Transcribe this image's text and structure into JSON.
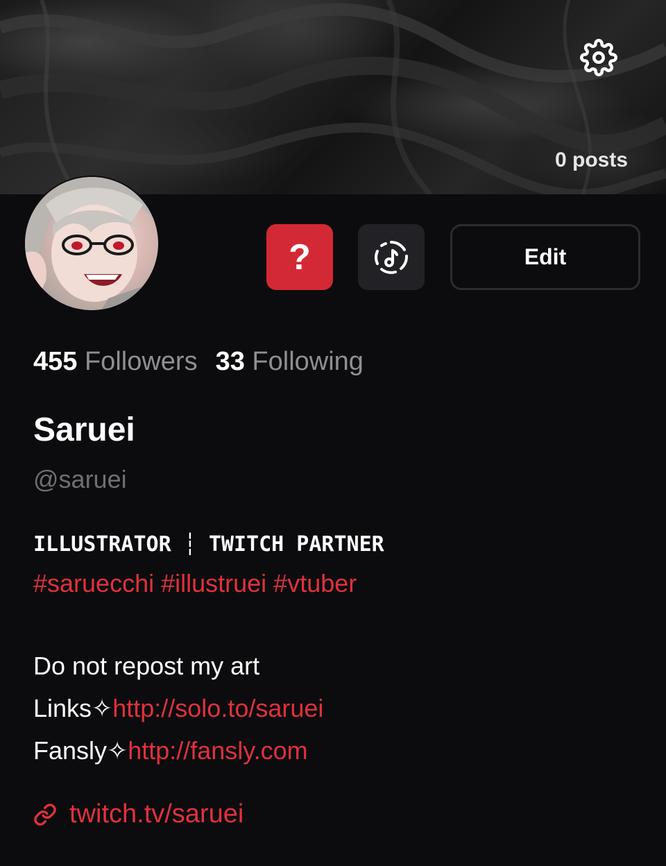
{
  "header": {
    "posts_label": "0 posts"
  },
  "actions": {
    "question_glyph": "?",
    "edit_label": "Edit"
  },
  "stats": {
    "followers_count": "455",
    "followers_label": "Followers",
    "following_count": "33",
    "following_label": "Following"
  },
  "profile": {
    "display_name": "Saruei",
    "handle": "@saruei"
  },
  "bio": {
    "title_left": "ILLUSTRATOR",
    "title_sep": "┆",
    "title_right": "TWITCH PARTNER",
    "hashtags": "#saruecchi #illustruei #vtuber",
    "notice": "Do not repost my art",
    "links_prefix": "Links✧",
    "links_url": "http://solo.to/saruei",
    "fansly_prefix": "Fansly✧",
    "fansly_url": "http://fansly.com"
  },
  "website": {
    "url": "twitch.tv/saruei"
  },
  "colors": {
    "background": "#0c0c0e",
    "accent": "#d32935",
    "muted": "#8f8f93"
  },
  "icons": {
    "settings": "gear-icon",
    "music": "music-note-icon",
    "link": "link-icon"
  }
}
